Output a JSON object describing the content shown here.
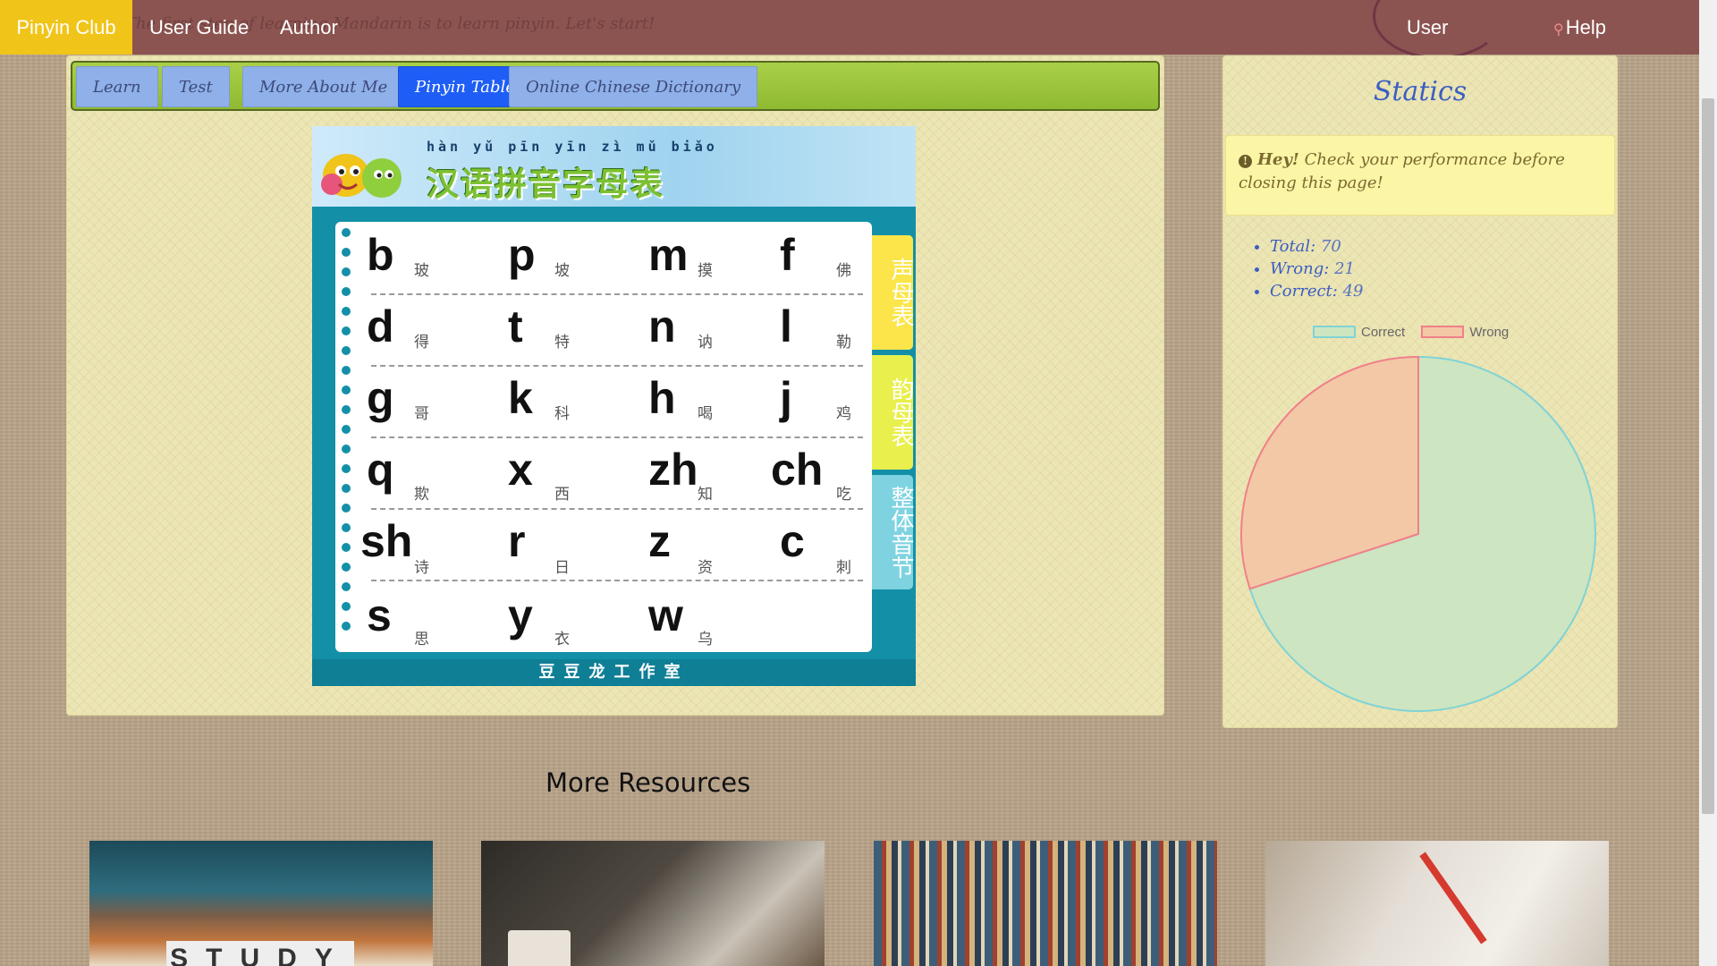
{
  "navbar": {
    "brand": "Pinyin Club",
    "links": [
      "User Guide",
      "Author"
    ],
    "marquee": "The first step of learning Mandarin is to learn pinyin. Let's start!",
    "user": "User",
    "help": "Help",
    "help_icon": "search-icon"
  },
  "tabs": [
    "Learn",
    "Test",
    "More About Me",
    "Pinyin Table",
    "Online Chinese Dictionary"
  ],
  "active_tab": "Pinyin Table",
  "pinyin_chart": {
    "pinyin_line": "hàn yǔ pīn yīn zì mǔ biǎo",
    "title": "汉语拼音字母表",
    "rows": [
      [
        {
          "l": "b",
          "c": "玻"
        },
        {
          "l": "p",
          "c": "坡"
        },
        {
          "l": "m",
          "c": "摸"
        },
        {
          "l": "f",
          "c": "佛"
        }
      ],
      [
        {
          "l": "d",
          "c": "得"
        },
        {
          "l": "t",
          "c": "特"
        },
        {
          "l": "n",
          "c": "讷"
        },
        {
          "l": "l",
          "c": "勒"
        }
      ],
      [
        {
          "l": "g",
          "c": "哥"
        },
        {
          "l": "k",
          "c": "科"
        },
        {
          "l": "h",
          "c": "喝"
        },
        {
          "l": "j",
          "c": "鸡"
        }
      ],
      [
        {
          "l": "q",
          "c": "欺"
        },
        {
          "l": "x",
          "c": "西"
        },
        {
          "l": "zh",
          "c": "知"
        },
        {
          "l": "ch",
          "c": "吃"
        }
      ],
      [
        {
          "l": "sh",
          "c": "诗"
        },
        {
          "l": "r",
          "c": "日"
        },
        {
          "l": "z",
          "c": "资"
        },
        {
          "l": "c",
          "c": "刺"
        }
      ],
      [
        {
          "l": "s",
          "c": "思"
        },
        {
          "l": "y",
          "c": "衣"
        },
        {
          "l": "w",
          "c": "乌"
        }
      ]
    ],
    "side_tabs": [
      "声母表",
      "韵母表",
      "整体音节"
    ],
    "footer": "豆豆龙工作室"
  },
  "stats": {
    "title": "Statics",
    "alert_strong": "Hey!",
    "alert_text": "Check your performance before closing this page!",
    "items": [
      {
        "label": "Total:",
        "value": "70"
      },
      {
        "label": "Wrong:",
        "value": "21"
      },
      {
        "label": "Correct:",
        "value": "49"
      }
    ],
    "legend": [
      "Correct",
      "Wrong"
    ]
  },
  "chart_data": {
    "type": "pie",
    "categories": [
      "Correct",
      "Wrong"
    ],
    "values": [
      49,
      21
    ],
    "colors": {
      "Correct": "#cde5c0",
      "Wrong": "#f3c8a6",
      "CorrectBorder": "#7fd3d6",
      "WrongBorder": "#f0808a"
    },
    "legend": "top"
  },
  "resources": {
    "title": "More Resources",
    "study_text": "STUDY"
  }
}
